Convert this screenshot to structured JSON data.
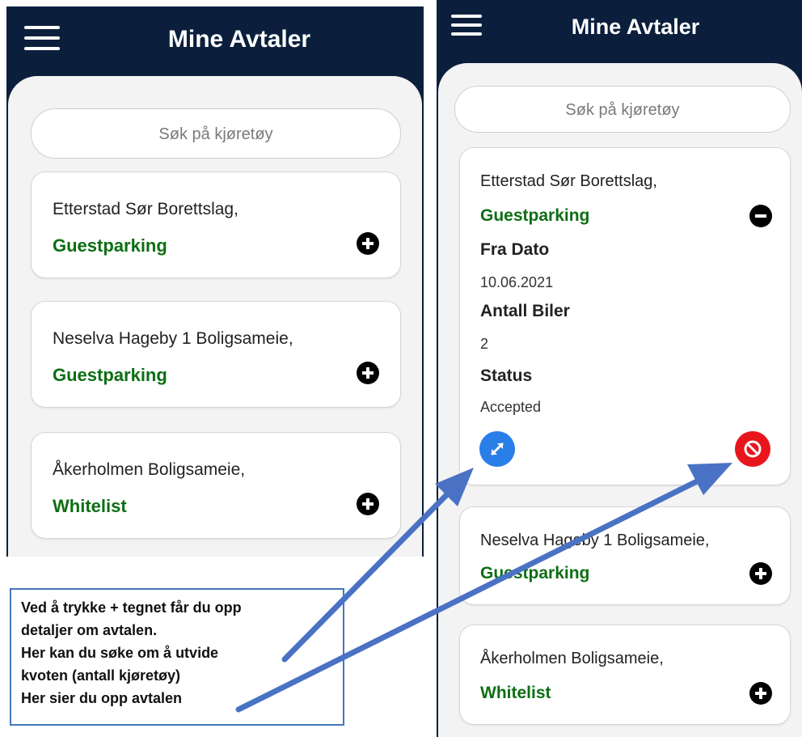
{
  "left_screen": {
    "title": "Mine Avtaler",
    "search": {
      "placeholder": "Søk på kjøretøy"
    },
    "agreements": [
      {
        "name": "Etterstad Sør Borettslag,",
        "type": "Guestparking"
      },
      {
        "name": "Neselva Hageby 1 Boligsameie,",
        "type": "Guestparking"
      },
      {
        "name": "Åkerholmen Boligsameie,",
        "type": "Whitelist"
      }
    ]
  },
  "right_screen": {
    "title": "Mine Avtaler",
    "search": {
      "placeholder": "Søk på kjøretøy"
    },
    "expanded": {
      "name": "Etterstad Sør Borettslag,",
      "type": "Guestparking",
      "from_date_label": "Fra Dato",
      "from_date": "10.06.2021",
      "cars_label": "Antall Biler",
      "cars": "2",
      "status_label": "Status",
      "status": "Accepted"
    },
    "agreements": [
      {
        "name": "Neselva Hageby 1 Boligsameie,",
        "type": "Guestparking"
      },
      {
        "name": "Åkerholmen Boligsameie,",
        "type": "Whitelist"
      }
    ]
  },
  "callout": {
    "lines": [
      "Ved å trykke + tegnet får du opp",
      "detaljer om avtalen.",
      "Her kan du søke om å utvide",
      "kvoten (antall kjøretøy)",
      "Her sier du opp avtalen"
    ]
  },
  "icons": {
    "menu": "hamburger-menu-icon",
    "expand": "plus-circle-icon",
    "collapse": "minus-circle-icon",
    "extend": "expand-arrows-icon",
    "cancel": "block-icon"
  },
  "colors": {
    "header": "#0b1f3d",
    "panel": "#f3f3f3",
    "type_text": "#0d6e14",
    "extend_button": "#2a7ee8",
    "cancel_button": "#e8161c",
    "arrow": "#4a72c4"
  }
}
